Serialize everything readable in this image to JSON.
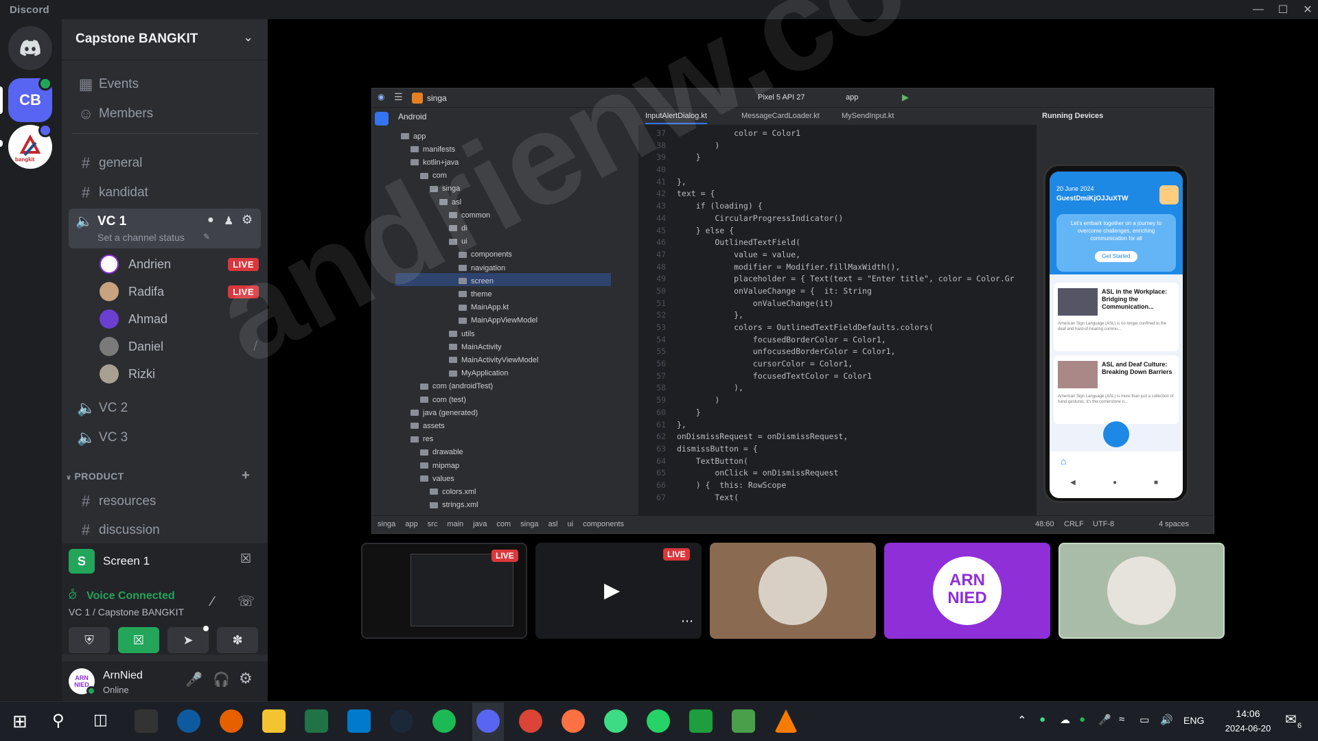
{
  "window": {
    "app_name": "Discord"
  },
  "server": {
    "name": "Capstone BANGKIT",
    "initials": "CB",
    "second_server_label": "bangkit"
  },
  "sidebar": {
    "events_label": "Events",
    "members_label": "Members",
    "channels": [
      {
        "name": "general"
      },
      {
        "name": "kandidat"
      }
    ],
    "voice": {
      "name": "VC 1",
      "status_placeholder": "Set a channel status",
      "members": [
        {
          "name": "Andrien",
          "live": "LIVE"
        },
        {
          "name": "Radifa",
          "live": "LIVE"
        },
        {
          "name": "Ahmad",
          "live": ""
        },
        {
          "name": "Daniel",
          "live": ""
        },
        {
          "name": "Rizki",
          "live": ""
        }
      ],
      "others": [
        "VC 2",
        "VC 3"
      ]
    },
    "category": "PRODUCT",
    "product_channels": [
      {
        "name": "resources"
      },
      {
        "name": "discussion"
      }
    ]
  },
  "screen_share": {
    "label": "Screen 1"
  },
  "voice_status": {
    "title": "Voice Connected",
    "location": "VC 1 / Capstone BANGKIT"
  },
  "user": {
    "name": "ArnNied",
    "status": "Online",
    "avatar_text": "ARN NIED"
  },
  "ide": {
    "project": "singa",
    "device": "Pixel 5 API 27",
    "module": "app",
    "view": "Android",
    "tabs": [
      "InputAlertDialog.kt",
      "MessageCardLoader.kt",
      "MySendInput.kt"
    ],
    "running_devices": "Running Devices",
    "tree": [
      {
        "label": "app",
        "depth": 0
      },
      {
        "label": "manifests",
        "depth": 1
      },
      {
        "label": "kotlin+java",
        "depth": 1
      },
      {
        "label": "com",
        "depth": 2
      },
      {
        "label": "singa",
        "depth": 3
      },
      {
        "label": "asl",
        "depth": 4
      },
      {
        "label": "common",
        "depth": 5
      },
      {
        "label": "di",
        "depth": 5
      },
      {
        "label": "ui",
        "depth": 5
      },
      {
        "label": "components",
        "depth": 6
      },
      {
        "label": "navigation",
        "depth": 6
      },
      {
        "label": "screen",
        "depth": 6
      },
      {
        "label": "theme",
        "depth": 6
      },
      {
        "label": "MainApp.kt",
        "depth": 6
      },
      {
        "label": "MainAppViewModel",
        "depth": 6
      },
      {
        "label": "utils",
        "depth": 5
      },
      {
        "label": "MainActivity",
        "depth": 5
      },
      {
        "label": "MainActivityViewModel",
        "depth": 5
      },
      {
        "label": "MyApplication",
        "depth": 5
      },
      {
        "label": "com (androidTest)",
        "depth": 2
      },
      {
        "label": "com (test)",
        "depth": 2
      },
      {
        "label": "java (generated)",
        "depth": 1
      },
      {
        "label": "assets",
        "depth": 1
      },
      {
        "label": "res",
        "depth": 1
      },
      {
        "label": "drawable",
        "depth": 2
      },
      {
        "label": "mipmap",
        "depth": 2
      },
      {
        "label": "values",
        "depth": 2
      },
      {
        "label": "colors.xml",
        "depth": 3
      },
      {
        "label": "strings.xml",
        "depth": 3
      }
    ],
    "line_numbers": [
      "37",
      "38",
      "39",
      "40",
      "41",
      "42",
      "43",
      "44",
      "45",
      "46",
      "47",
      "48",
      "49",
      "50",
      "51",
      "52",
      "53",
      "54",
      "55",
      "56",
      "57",
      "58",
      "59",
      "60",
      "61",
      "62",
      "63",
      "64",
      "65",
      "66",
      "67"
    ],
    "code_lines": [
      "            color = Color1",
      "        )",
      "    }",
      "",
      "},",
      "text = {",
      "    if (loading) {",
      "        CircularProgressIndicator()",
      "    } else {",
      "        OutlinedTextField(",
      "            value = value,",
      "            modifier = Modifier.fillMaxWidth(),",
      "            placeholder = { Text(text = \"Enter title\", color = Color.Gr",
      "            onValueChange = {  it: String",
      "                onValueChange(it)",
      "            },",
      "            colors = OutlinedTextFieldDefaults.colors(",
      "                focusedBorderColor = Color1,",
      "                unfocusedBorderColor = Color1,",
      "                cursorColor = Color1,",
      "                focusedTextColor = Color1",
      "            ),",
      "        )",
      "    }",
      "},",
      "onDismissRequest = onDismissRequest,",
      "dismissButton = {",
      "    TextButton(",
      "        onClick = onDismissRequest",
      "    ) {  this: RowScope",
      "        Text("
    ],
    "breadcrumb": [
      "singa",
      "app",
      "src",
      "main",
      "java",
      "com",
      "singa",
      "asl",
      "ui",
      "components"
    ],
    "status": {
      "position": "48:60",
      "line_ending": "CRLF",
      "encoding": "UTF-8",
      "indent": "4 spaces"
    }
  },
  "phone": {
    "date": "20 June 2024",
    "user": "GuestDmiKjOJJuXTW",
    "banner_text": "Let's embark together on a journey to overcome challenges, enriching communication for all",
    "banner_button": "Get Started",
    "articles": [
      {
        "title": "ASL in the Workplace: Bridging the Communication...",
        "snippet": "American Sign Language (ASL) is no longer confined to the deaf and hard-of-hearing commu..."
      },
      {
        "title": "ASL and Deaf Culture: Breaking Down Barriers",
        "snippet": "American Sign Language (ASL) is more than just a collection of hand gestures; it's the cornerstone o..."
      }
    ]
  },
  "tiles": {
    "live_label": "LIVE",
    "avatar_text": "ARN NIED"
  },
  "watermark": "andrienw.co",
  "clock": {
    "time": "14:06",
    "date": "2024-06-20"
  },
  "tray": {
    "language": "ENG",
    "notifications": "6"
  },
  "colors": {
    "discord_bg": "#2b2d31",
    "rail_bg": "#1e1f22",
    "live_red": "#da373c",
    "voice_green": "#23a55a",
    "purple_tile": "#8e2fd8",
    "cb_blue": "#5865f2"
  }
}
